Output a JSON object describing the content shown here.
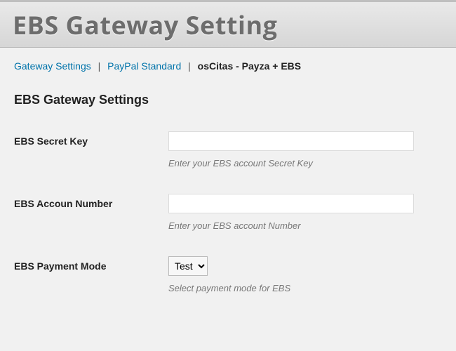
{
  "header": {
    "title": "EBS Gateway Setting"
  },
  "breadcrumb": {
    "items": [
      {
        "label": "Gateway Settings",
        "link": true
      },
      {
        "label": "PayPal Standard",
        "link": true
      },
      {
        "label": "osCitas - Payza + EBS",
        "link": false
      }
    ],
    "separator": "|"
  },
  "section": {
    "title": "EBS Gateway Settings"
  },
  "fields": {
    "secret_key": {
      "label": "EBS Secret Key",
      "value": "",
      "help": "Enter your EBS account Secret Key"
    },
    "account_number": {
      "label": "EBS Accoun Number",
      "value": "",
      "help": "Enter your EBS account Number"
    },
    "payment_mode": {
      "label": "EBS Payment Mode",
      "selected": "Test",
      "help": "Select payment mode for EBS"
    }
  }
}
